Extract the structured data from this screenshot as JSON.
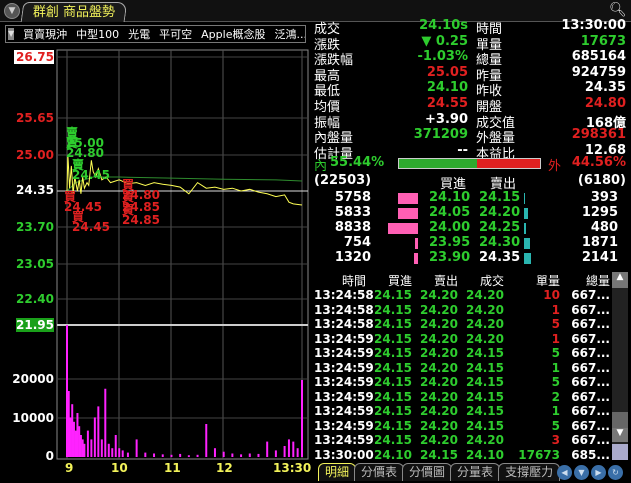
{
  "window": {
    "title": "群創 商品盤勢",
    "menu_icon": "chevron-down-icon",
    "zoom_icon": "magnifier-icon"
  },
  "groups": [
    "買賣現沖",
    "中型100",
    "光電",
    "平可空",
    "Apple概念股",
    "泛鴻..."
  ],
  "quote": {
    "left": [
      {
        "label": "成交",
        "value": "24.10s",
        "color": "green"
      },
      {
        "label": "漲跌",
        "value": "▼ 0.25",
        "color": "green"
      },
      {
        "label": "漲跌幅",
        "value": "-1.03%",
        "color": "green"
      },
      {
        "label": "最高",
        "value": "25.05",
        "color": "red"
      },
      {
        "label": "最低",
        "value": "24.10",
        "color": "green"
      },
      {
        "label": "均價",
        "value": "24.55",
        "color": "red"
      },
      {
        "label": "振幅",
        "value": "+3.90",
        "color": "white"
      },
      {
        "label": "內盤量",
        "value": "371209",
        "color": "green"
      },
      {
        "label": "估計量",
        "value": "--",
        "color": "white"
      }
    ],
    "right": [
      {
        "label": "時間",
        "value": "13:30:00",
        "color": "white"
      },
      {
        "label": "單量",
        "value": "17673",
        "color": "green"
      },
      {
        "label": "總量",
        "value": "685164",
        "color": "white"
      },
      {
        "label": "昨量",
        "value": "924759",
        "color": "white"
      },
      {
        "label": "昨收",
        "value": "24.35",
        "color": "white"
      },
      {
        "label": "開盤",
        "value": "24.80",
        "color": "red"
      },
      {
        "label": "成交值",
        "value": "168億",
        "color": "white"
      },
      {
        "label": "外盤量",
        "value": "298361",
        "color": "red"
      },
      {
        "label": "本益比",
        "value": "12.68",
        "color": "white"
      }
    ]
  },
  "ratio": {
    "inner_label": "內",
    "inner_pct": "55.44%",
    "outer_label": "外",
    "outer_pct": "44.56%",
    "inner_fraction": 0.5544
  },
  "orderbook": {
    "bid_total": "(22503)",
    "ask_total": "(6180)",
    "bid_header": "買進",
    "ask_header": "賣出",
    "rows": [
      {
        "bid_vol": "5758",
        "bid": "24.10",
        "ask": "24.15",
        "ask_vol": "393"
      },
      {
        "bid_vol": "5833",
        "bid": "24.05",
        "ask": "24.20",
        "ask_vol": "1295"
      },
      {
        "bid_vol": "8838",
        "bid": "24.00",
        "ask": "24.25",
        "ask_vol": "480"
      },
      {
        "bid_vol": "754",
        "bid": "23.95",
        "ask": "24.30",
        "ask_vol": "1871"
      },
      {
        "bid_vol": "1320",
        "bid": "23.90",
        "ask": "24.35",
        "ask_vol": "2141"
      }
    ]
  },
  "ticks": {
    "headers": [
      "時間",
      "買進",
      "賣出",
      "成交",
      "單量",
      "總量"
    ],
    "rows": [
      [
        "13:24:58",
        "24.15",
        "24.20",
        "24.20",
        "10",
        "667..."
      ],
      [
        "13:24:58",
        "24.15",
        "24.20",
        "24.20",
        "1",
        "667..."
      ],
      [
        "13:24:58",
        "24.15",
        "24.20",
        "24.20",
        "5",
        "667..."
      ],
      [
        "13:24:59",
        "24.15",
        "24.20",
        "24.20",
        "1",
        "667..."
      ],
      [
        "13:24:59",
        "24.15",
        "24.20",
        "24.15",
        "5",
        "667..."
      ],
      [
        "13:24:59",
        "24.15",
        "24.20",
        "24.15",
        "1",
        "667..."
      ],
      [
        "13:24:59",
        "24.15",
        "24.20",
        "24.15",
        "5",
        "667..."
      ],
      [
        "13:24:59",
        "24.15",
        "24.20",
        "24.15",
        "2",
        "667..."
      ],
      [
        "13:24:59",
        "24.15",
        "24.20",
        "24.15",
        "1",
        "667..."
      ],
      [
        "13:24:59",
        "24.15",
        "24.20",
        "24.15",
        "5",
        "667..."
      ],
      [
        "13:24:59",
        "24.15",
        "24.20",
        "24.20",
        "3",
        "667..."
      ],
      [
        "13:30:00",
        "24.10",
        "24.15",
        "24.10",
        "17673",
        "685..."
      ]
    ]
  },
  "tabs": [
    "明細",
    "分價表",
    "分價圖",
    "分量表",
    "支撐壓力"
  ],
  "chart_data": {
    "type": "line",
    "price_ticks": [
      "26.75",
      "25.65",
      "25.00",
      "24.35",
      "23.70",
      "23.05",
      "22.40",
      "21.95"
    ],
    "volume_ticks": [
      "20000",
      "10000",
      "0"
    ],
    "x_ticks": [
      "9",
      "10",
      "11",
      "12",
      "13:30"
    ],
    "ylim": [
      21.95,
      26.75
    ],
    "prev_close": 24.35,
    "volume_max": 30000,
    "price": {
      "x": [
        0,
        1,
        3,
        5,
        7,
        9,
        12,
        14,
        16,
        18,
        20,
        23,
        25,
        28,
        30,
        33,
        36,
        40,
        45,
        50,
        60,
        70,
        80,
        90,
        100,
        110,
        120,
        130,
        140,
        150,
        160,
        170,
        180,
        190,
        200,
        210,
        220,
        230,
        240,
        250,
        255,
        260,
        270
      ],
      "y": [
        24.35,
        25.0,
        24.4,
        24.8,
        24.3,
        24.6,
        24.35,
        24.55,
        24.3,
        24.6,
        24.4,
        24.5,
        24.45,
        24.9,
        24.7,
        24.6,
        24.75,
        24.55,
        24.6,
        24.5,
        24.55,
        24.48,
        24.5,
        24.45,
        24.5,
        24.47,
        24.45,
        24.42,
        24.3,
        24.5,
        24.4,
        24.42,
        24.38,
        24.4,
        24.35,
        24.38,
        24.33,
        24.3,
        24.25,
        24.28,
        24.15,
        24.12,
        24.1
      ]
    },
    "average": {
      "x": [
        0,
        10,
        30,
        60,
        120,
        180,
        240,
        270
      ],
      "y": [
        24.35,
        24.5,
        24.6,
        24.6,
        24.58,
        24.56,
        24.55,
        24.53
      ]
    },
    "volume": {
      "x": [
        0,
        2,
        4,
        6,
        8,
        10,
        12,
        14,
        16,
        18,
        20,
        24,
        28,
        32,
        36,
        40,
        44,
        48,
        52,
        56,
        60,
        64,
        70,
        80,
        90,
        100,
        110,
        120,
        130,
        140,
        150,
        160,
        170,
        180,
        190,
        200,
        210,
        220,
        230,
        240,
        250,
        255,
        260,
        265,
        270
      ],
      "y": [
        30000,
        15000,
        9000,
        12000,
        8000,
        6000,
        10000,
        7000,
        5000,
        4000,
        3000,
        6000,
        4000,
        9000,
        11500,
        4000,
        15500,
        3000,
        2000,
        5000,
        2000,
        1500,
        1000,
        4000,
        1000,
        800,
        600,
        500,
        700,
        400,
        500,
        7500,
        2000,
        1200,
        800,
        600,
        800,
        700,
        3500,
        1500,
        2500,
        4000,
        3500,
        2000,
        17500
      ]
    },
    "annotations": [
      {
        "text": "賣25.00",
        "color": "green"
      },
      {
        "text": "賣24.80",
        "color": "green"
      },
      {
        "text": "賣24.45",
        "color": "green"
      },
      {
        "text": "買24.45",
        "color": "red"
      },
      {
        "text": "買24.45",
        "color": "red"
      },
      {
        "text": "買24.80",
        "color": "red"
      },
      {
        "text": "買24.85",
        "color": "red"
      },
      {
        "text": "買24.85",
        "color": "red"
      }
    ]
  }
}
